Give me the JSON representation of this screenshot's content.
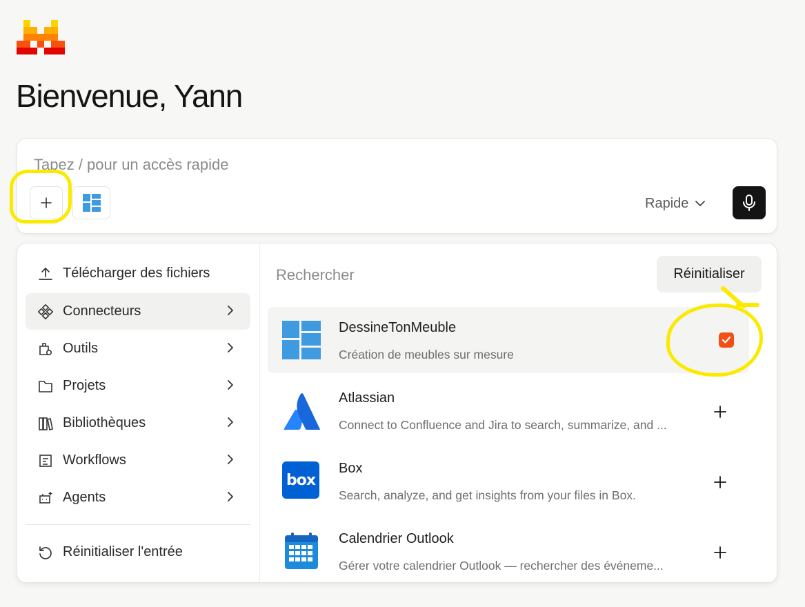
{
  "app": {
    "logo": "mistral-pixel-logo",
    "greeting": "Bienvenue, Yann"
  },
  "chat": {
    "placeholder": "Tapez / pour un accès rapide",
    "add_icon": "plus-icon",
    "connector_chip_icon": "dessinetonmeuble-icon",
    "mode": "Rapide",
    "mode_icon": "chevron-down-icon",
    "mic_icon": "microphone-icon"
  },
  "menu": {
    "items": [
      {
        "label": "Télécharger des fichiers",
        "icon": "upload-icon",
        "has_submenu": false,
        "active": false
      },
      {
        "label": "Connecteurs",
        "icon": "connectors-icon",
        "has_submenu": true,
        "active": true
      },
      {
        "label": "Outils",
        "icon": "tools-icon",
        "has_submenu": true,
        "active": false
      },
      {
        "label": "Projets",
        "icon": "folder-icon",
        "has_submenu": true,
        "active": false
      },
      {
        "label": "Bibliothèques",
        "icon": "library-icon",
        "has_submenu": true,
        "active": false
      },
      {
        "label": "Workflows",
        "icon": "workflow-icon",
        "has_submenu": true,
        "active": false
      },
      {
        "label": "Agents",
        "icon": "agent-icon",
        "has_submenu": true,
        "active": false
      }
    ],
    "reset_input": {
      "label": "Réinitialiser l'entrée",
      "icon": "reset-icon"
    }
  },
  "connectors": {
    "search_placeholder": "Rechercher",
    "reset_label": "Réinitialiser",
    "items": [
      {
        "name": "DessineTonMeuble",
        "description": "Création de meubles sur mesure",
        "logo": "dessinetonmeuble-logo",
        "selected": true,
        "action_icon": "checkbox-checked-icon"
      },
      {
        "name": "Atlassian",
        "description": "Connect to Confluence and Jira to search, summarize, and ...",
        "logo": "atlassian-logo",
        "selected": false,
        "action_icon": "plus-icon"
      },
      {
        "name": "Box",
        "description": "Search, analyze, and get insights from your files in Box.",
        "logo": "box-logo",
        "logo_text": "box",
        "selected": false,
        "action_icon": "plus-icon"
      },
      {
        "name": "Calendrier Outlook",
        "description": "Gérer votre calendrier Outlook — rechercher des événeme...",
        "logo": "outlook-calendar-logo",
        "selected": false,
        "action_icon": "plus-icon"
      }
    ]
  },
  "colors": {
    "brand_orange": "#f24f17",
    "highlight_yellow": "#fbea00",
    "mic_button": "#141414",
    "dtm_blue": "#3f9ae0",
    "atlassian_blue": "#1868db",
    "box_blue": "#0061d5",
    "outlook_blue": "#1d8bdc"
  }
}
